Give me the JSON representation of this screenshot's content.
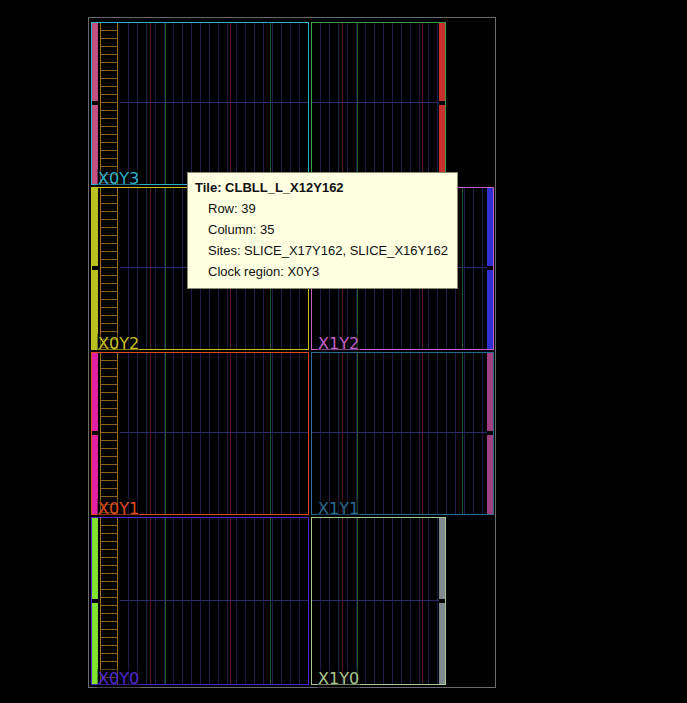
{
  "device": {
    "clock_regions": [
      {
        "label": "X0Y3",
        "color": "#2ab0c8",
        "edge_color": "#c05080",
        "kind": "wide",
        "side": "left"
      },
      {
        "color": "#3f9a45",
        "edge_color": "#c83030",
        "kind": "narrow",
        "side": "right"
      },
      {
        "label": "X0Y2",
        "color": "#c8c020",
        "edge_color": "#b8c020",
        "kind": "wide",
        "side": "left"
      },
      {
        "label": "X1Y2",
        "color": "#c060c8",
        "edge_color": "#3030d0",
        "kind": "wide",
        "side": "right"
      },
      {
        "label": "X0Y1",
        "color": "#e04a20",
        "edge_color": "#e020a0",
        "kind": "wide",
        "side": "left"
      },
      {
        "label": "X1Y1",
        "color": "#2a6a90",
        "edge_color": "#a04080",
        "kind": "wide",
        "side": "right"
      },
      {
        "label": "X0Y0",
        "color": "#5028d0",
        "edge_color": "#80e030",
        "kind": "wide",
        "side": "left"
      },
      {
        "label": "X1Y0",
        "color": "#a8c890",
        "edge_color": "#808890",
        "kind": "narrow",
        "side": "right"
      }
    ]
  },
  "tooltip": {
    "title": "Tile: CLBLL_L_X12Y162",
    "lines": [
      "Row: 39",
      "Column: 35",
      "Sites: SLICE_X17Y162, SLICE_X16Y162",
      "Clock region: X0Y3"
    ]
  }
}
